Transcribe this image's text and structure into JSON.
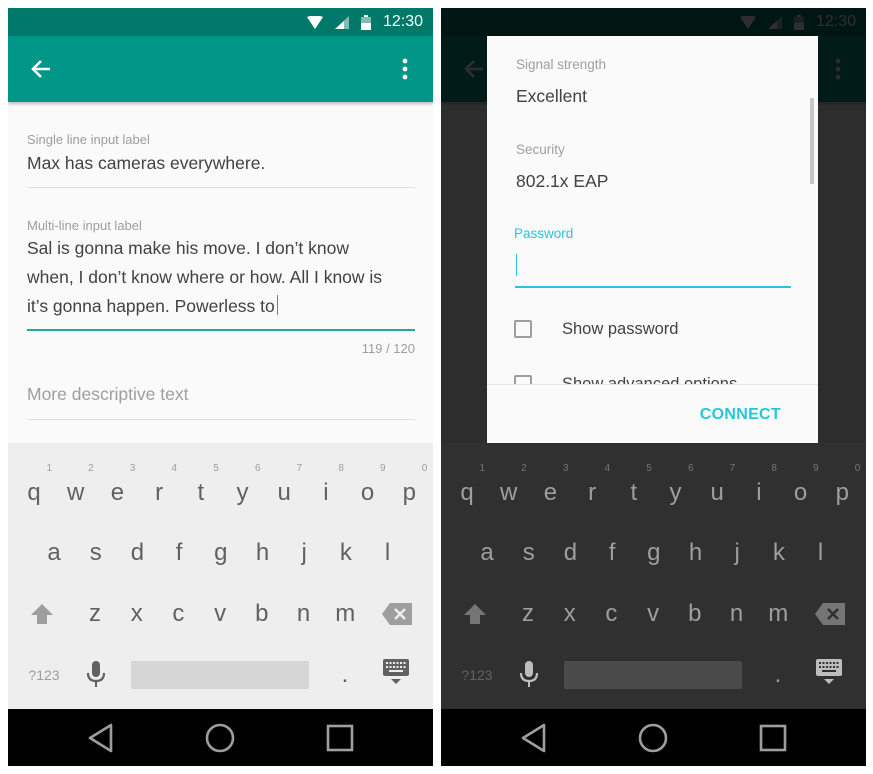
{
  "left_screen": {
    "status_bar": {
      "time": "12:30",
      "icons": [
        "wifi-icon",
        "cell-signal-icon",
        "battery-icon"
      ]
    },
    "app_bar": {
      "back_icon": "arrow-back-icon",
      "overflow_icon": "more-vert-icon"
    },
    "fields": {
      "single_line": {
        "label": "Single line input label",
        "value": "Max has cameras everywhere."
      },
      "multi_line": {
        "label": "Multi-line input label",
        "lines": [
          "Sal is gonna make his move. I don’t know",
          "when, I don’t know where or how. All I know is",
          "it’s gonna happen. Powerless to"
        ],
        "counter": "119 / 120"
      },
      "descriptive": {
        "placeholder": "More descriptive text"
      }
    },
    "colors": {
      "primary": "#009688",
      "primary_dark": "#00796b",
      "accent": "#26a69a"
    }
  },
  "right_screen": {
    "status_bar": {
      "time": "12:30"
    },
    "dialog": {
      "signal_label": "Signal strength",
      "signal_value": "Excellent",
      "security_label": "Security",
      "security_value": "802.1x EAP",
      "password_label": "Password",
      "password_value": "",
      "show_password": {
        "label": "Show password",
        "checked": false
      },
      "show_advanced": {
        "label": "Show advanced options",
        "checked": false
      },
      "connect_label": "CONNECT"
    },
    "colors": {
      "accent": "#26c6da"
    }
  },
  "keyboard": {
    "row1": [
      {
        "ch": "q",
        "hint": "1"
      },
      {
        "ch": "w",
        "hint": "2"
      },
      {
        "ch": "e",
        "hint": "3"
      },
      {
        "ch": "r",
        "hint": "4"
      },
      {
        "ch": "t",
        "hint": "5"
      },
      {
        "ch": "y",
        "hint": "6"
      },
      {
        "ch": "u",
        "hint": "7"
      },
      {
        "ch": "i",
        "hint": "8"
      },
      {
        "ch": "o",
        "hint": "9"
      },
      {
        "ch": "p",
        "hint": "0"
      }
    ],
    "row2": [
      "a",
      "s",
      "d",
      "f",
      "g",
      "h",
      "j",
      "k",
      "l"
    ],
    "row3": [
      "z",
      "x",
      "c",
      "v",
      "b",
      "n",
      "m"
    ],
    "symbols_label": "?123",
    "period_label": ".",
    "icons": {
      "shift": "shift-icon",
      "backspace": "backspace-icon",
      "mic": "mic-icon",
      "hide": "keyboard-hide-icon"
    }
  },
  "nav_bar": {
    "icons": [
      "back-triangle-icon",
      "home-circle-icon",
      "recents-square-icon"
    ]
  }
}
